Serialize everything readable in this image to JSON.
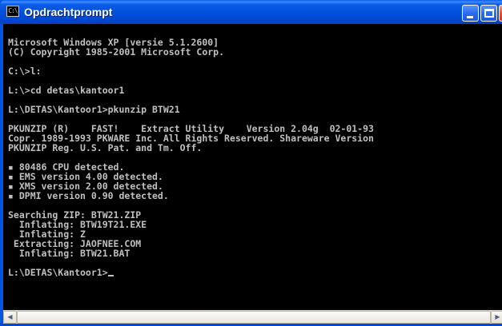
{
  "window": {
    "title": "Opdrachtprompt",
    "icon": "console-icon",
    "icon_glyph": "C:\\",
    "controls": {
      "minimize": "minimize-icon",
      "maximize": "maximize-icon",
      "close": "close-icon"
    },
    "colors": {
      "titlebar": "#0054e3",
      "console_bg": "#000000",
      "console_fg": "#c0c0c0"
    }
  },
  "console": {
    "lines": [
      "Microsoft Windows XP [versie 5.1.2600]",
      "(C) Copyright 1985-2001 Microsoft Corp.",
      "",
      "C:\\>l:",
      "",
      "L:\\>cd detas\\kantoor1",
      "",
      "L:\\DETAS\\Kantoor1>pkunzip BTW21",
      "",
      "PKUNZIP (R)    FAST!    Extract Utility    Version 2.04g  02-01-93",
      "Copr. 1989-1993 PKWARE Inc. All Rights Reserved. Shareware Version",
      "PKUNZIP Reg. U.S. Pat. and Tm. Off.",
      "",
      "▪ 80486 CPU detected.",
      "▪ EMS version 4.00 detected.",
      "▪ XMS version 2.00 detected.",
      "▪ DPMI version 0.90 detected.",
      "",
      "Searching ZIP: BTW21.ZIP",
      "  Inflating: BTW19T21.EXE",
      "  Inflating: Z",
      " Extracting: JAOFNEE.COM",
      "  Inflating: BTW21.BAT",
      "",
      "L:\\DETAS\\Kantoor1>"
    ],
    "prompt": "L:\\DETAS\\Kantoor1>"
  },
  "scrollbar": {
    "left_arrow": "◀",
    "right_arrow": "▶"
  }
}
